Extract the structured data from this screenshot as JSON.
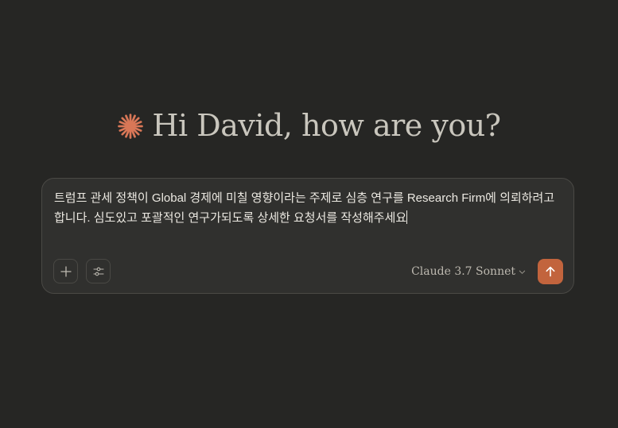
{
  "greeting": {
    "text": "Hi David, how are you?",
    "icon": "claude-spark-icon",
    "icon_color": "#d97757"
  },
  "composer": {
    "prompt_value": "트럼프 관세 정책이 Global 경제에 미칠 영향이라는 주제로 심층 연구를 Research Firm에 의뢰하려고 합니다. 심도있고 포괄적인 연구가되도록 상세한 요청서를 작성해주세요",
    "add_button_icon": "plus-icon",
    "tools_button_icon": "sliders-icon",
    "model_label": "Claude 3.7 Sonnet",
    "model_dropdown_icon": "chevron-down-icon",
    "send_button_icon": "arrow-up-icon",
    "send_button_color": "#c2643d"
  }
}
